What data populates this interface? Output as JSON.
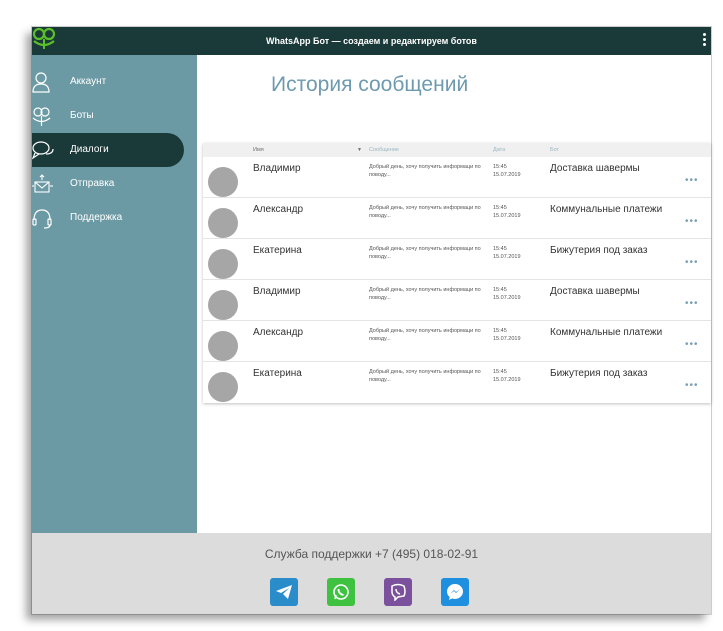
{
  "app": {
    "title": "WhatsApp Бот — создаем и редактируем ботов",
    "brand_color": "#1a3a39",
    "accent_green": "#5cbf2a",
    "sidebar_color": "#6c9aa4"
  },
  "sidebar": {
    "items": [
      {
        "label": "Аккаунт",
        "icon": "user-icon",
        "active": false
      },
      {
        "label": "Боты",
        "icon": "bot-icon",
        "active": false
      },
      {
        "label": "Диалоги",
        "icon": "chat-icon",
        "active": true
      },
      {
        "label": "Отправка",
        "icon": "send-mail-icon",
        "active": false
      },
      {
        "label": "Поддержка",
        "icon": "headset-icon",
        "active": false
      }
    ]
  },
  "main": {
    "title": "История сообщений",
    "table": {
      "headers": {
        "name": "Имя",
        "message": "Сообщение",
        "date": "Дата",
        "bot": "Бот"
      },
      "rows": [
        {
          "name": "Владимир",
          "message": "Добрый день, хочу получить информаци по поводу...",
          "time": "15:45",
          "date": "15.07.2019",
          "bot": "Доставка шавермы"
        },
        {
          "name": "Александр",
          "message": "Добрый день, хочу получить информаци по поводу...",
          "time": "15:45",
          "date": "15.07.2019",
          "bot": "Коммунальные платежи"
        },
        {
          "name": "Екатерина",
          "message": "Добрый день, хочу получить информаци по поводу...",
          "time": "15:45",
          "date": "15.07.2019",
          "bot": "Бижутерия под заказ"
        },
        {
          "name": "Владимир",
          "message": "Добрый день, хочу получить информаци по поводу...",
          "time": "15:45",
          "date": "15.07.2019",
          "bot": "Доставка шавермы"
        },
        {
          "name": "Александр",
          "message": "Добрый день, хочу получить информаци по поводу...",
          "time": "15:45",
          "date": "15.07.2019",
          "bot": "Коммунальные платежи"
        },
        {
          "name": "Екатерина",
          "message": "Добрый день, хочу получить информаци по поводу...",
          "time": "15:45",
          "date": "15.07.2019",
          "bot": "Бижутерия под заказ"
        }
      ],
      "more_label": "•••"
    }
  },
  "footer": {
    "support": "Служба поддержки +7 (495) 018-02-91",
    "social": [
      {
        "icon": "telegram-icon",
        "color": "#2a8cc8"
      },
      {
        "icon": "whatsapp-icon",
        "color": "#3fc240"
      },
      {
        "icon": "viber-icon",
        "color": "#7b519d"
      },
      {
        "icon": "messenger-icon",
        "color": "#1f8fe0"
      }
    ]
  }
}
